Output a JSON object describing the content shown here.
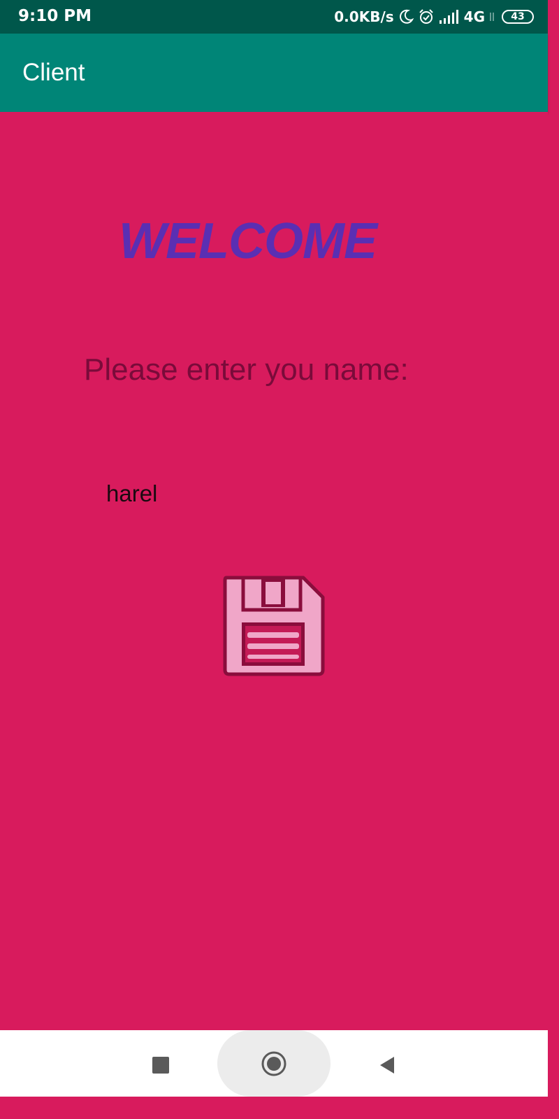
{
  "status_bar": {
    "time": "9:10 PM",
    "net_speed": "0.0KB/s",
    "network_type": "4G",
    "battery_level": "43"
  },
  "app_bar": {
    "title": "Client"
  },
  "content": {
    "heading": "WELCOME",
    "prompt": "Please enter you name:",
    "name_input_value": "harel",
    "save_icon": "floppy-disk-save-icon"
  },
  "nav_bar": {
    "recents_icon": "square-recents-icon",
    "home_icon": "circle-home-icon",
    "back_icon": "triangle-back-icon"
  },
  "colors": {
    "status_bar": "#00574b",
    "app_bar": "#008577",
    "background": "#d81b5d",
    "heading": "#5a2fb3",
    "prompt_text": "#7a0b3a",
    "save_icon_fill": "#f0a6c8",
    "save_icon_outline": "#8a0d3c"
  }
}
